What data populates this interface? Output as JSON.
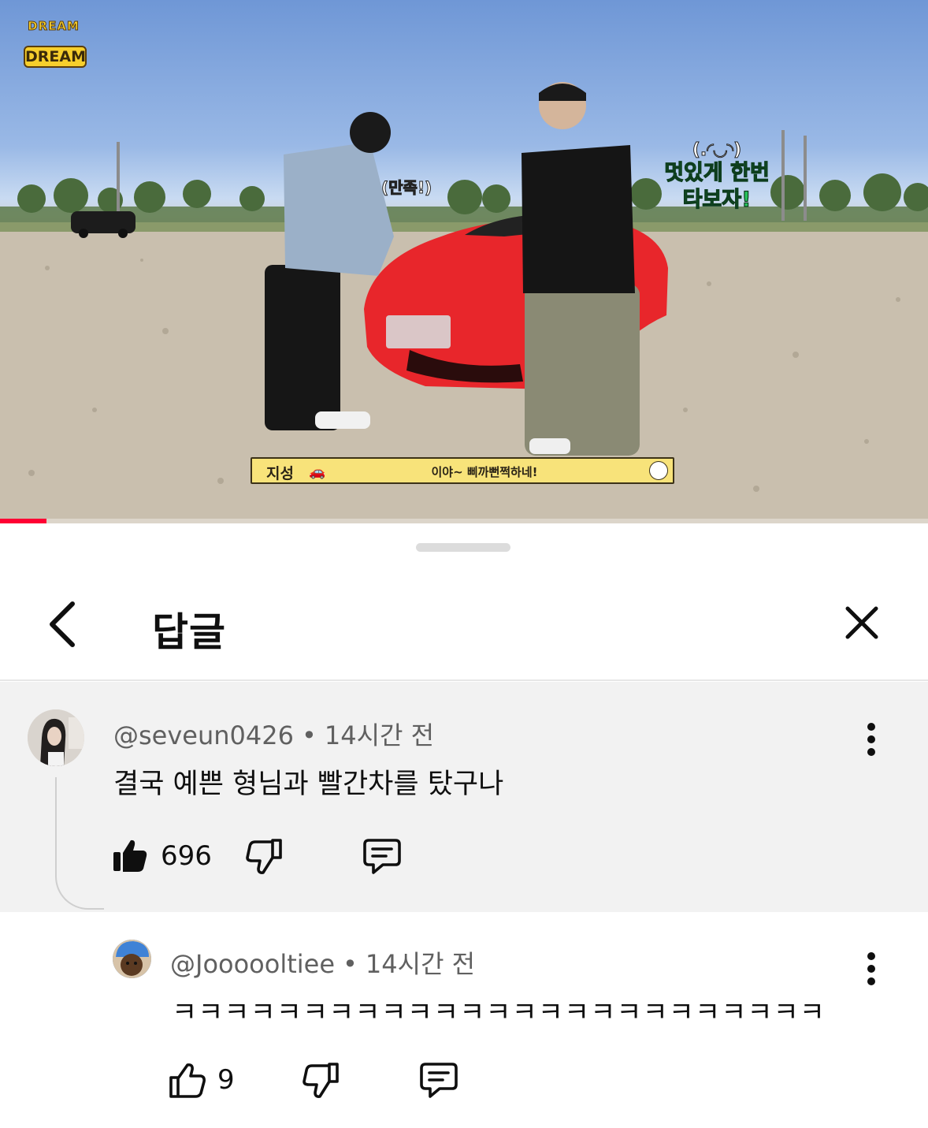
{
  "video": {
    "channel_logo_top": "DREAM",
    "channel_logo_bottom": "DREAM",
    "caption_small": "(만족!)",
    "caption_kaomoji": "(.◜◡◝)",
    "caption_line1": "멋있게 한번",
    "caption_line2": "타보자!",
    "subtitle_name": "지성",
    "subtitle_text": "이야~ 삐까뻔쩍하네!",
    "progress_fraction": 0.05,
    "car_color": "#e8262b",
    "progress_color": "#ff0033"
  },
  "header": {
    "back_icon": "chevron-left-icon",
    "title": "답글",
    "close_icon": "close-icon"
  },
  "parent_comment": {
    "author": "@seveun0426",
    "separator": "•",
    "time": "14시간 전",
    "text": "결국 예쁜 형님과 빨간차를 탔구나",
    "likes": "696",
    "liked": true
  },
  "reply_comment": {
    "author": "@Joooooltiee",
    "separator": "•",
    "time": "14시간 전",
    "text": "ㅋㅋㅋㅋㅋㅋㅋㅋㅋㅋㅋㅋㅋㅋㅋㅋㅋㅋㅋㅋㅋㅋㅋㅋㅋ",
    "likes": "9",
    "liked": false
  },
  "colors": {
    "parent_highlight": "#f2f2f2",
    "text_primary": "#0f0f0f",
    "text_secondary": "#606060"
  }
}
